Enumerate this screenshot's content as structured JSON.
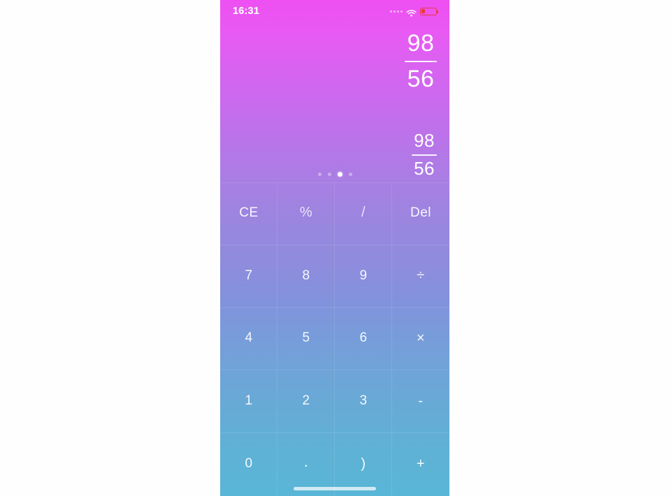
{
  "app": {
    "name": "Calculator",
    "theme": {
      "gradient_top": "#ee4ff2",
      "gradient_mid": "#8f8cdd",
      "gradient_bottom": "#59b6d6",
      "text_color": "#ffffff",
      "battery_low_color": "#e8393f"
    }
  },
  "status_bar": {
    "time": "16:31",
    "signal_icon": "signal-dots-icon",
    "wifi_icon": "wifi-icon",
    "battery_icon": "battery-low-icon",
    "battery_level_percent": 15
  },
  "display": {
    "expression": {
      "type": "fraction",
      "numerator": "98",
      "denominator": "56",
      "raw": "98/56"
    },
    "result": {
      "type": "fraction",
      "numerator": "98",
      "denominator": "56",
      "raw": "98/56"
    }
  },
  "page_indicator": {
    "total": 4,
    "active_index": 2,
    "dots": [
      {
        "name": "page-dot-1",
        "active": false
      },
      {
        "name": "page-dot-2",
        "active": false
      },
      {
        "name": "page-dot-3",
        "active": true
      },
      {
        "name": "page-dot-4",
        "active": false
      }
    ]
  },
  "keypad": {
    "rows": [
      [
        {
          "name": "key-clear-entry",
          "label": "CE",
          "style": "bright"
        },
        {
          "name": "key-percent",
          "label": "%",
          "style": "dim"
        },
        {
          "name": "key-slash",
          "label": "/",
          "style": "dim"
        },
        {
          "name": "key-delete",
          "label": "Del",
          "style": "bright"
        }
      ],
      [
        {
          "name": "key-7",
          "label": "7",
          "style": "bright"
        },
        {
          "name": "key-8",
          "label": "8",
          "style": "bright"
        },
        {
          "name": "key-9",
          "label": "9",
          "style": "bright"
        },
        {
          "name": "key-divide",
          "label": "÷",
          "style": "bright"
        }
      ],
      [
        {
          "name": "key-4",
          "label": "4",
          "style": "bright"
        },
        {
          "name": "key-5",
          "label": "5",
          "style": "bright"
        },
        {
          "name": "key-6",
          "label": "6",
          "style": "bright"
        },
        {
          "name": "key-multiply",
          "label": "×",
          "style": "bright"
        }
      ],
      [
        {
          "name": "key-1",
          "label": "1",
          "style": "bright"
        },
        {
          "name": "key-2",
          "label": "2",
          "style": "bright"
        },
        {
          "name": "key-3",
          "label": "3",
          "style": "bright"
        },
        {
          "name": "key-subtract",
          "label": "-",
          "style": "bright"
        }
      ],
      [
        {
          "name": "key-0",
          "label": "0",
          "style": "bright"
        },
        {
          "name": "key-decimal-point",
          "label": ".",
          "style": "bright"
        },
        {
          "name": "key-close-paren",
          "label": ")",
          "style": "bright"
        },
        {
          "name": "key-add",
          "label": "+",
          "style": "bright"
        }
      ]
    ]
  },
  "home_indicator": {
    "name": "home-indicator"
  }
}
